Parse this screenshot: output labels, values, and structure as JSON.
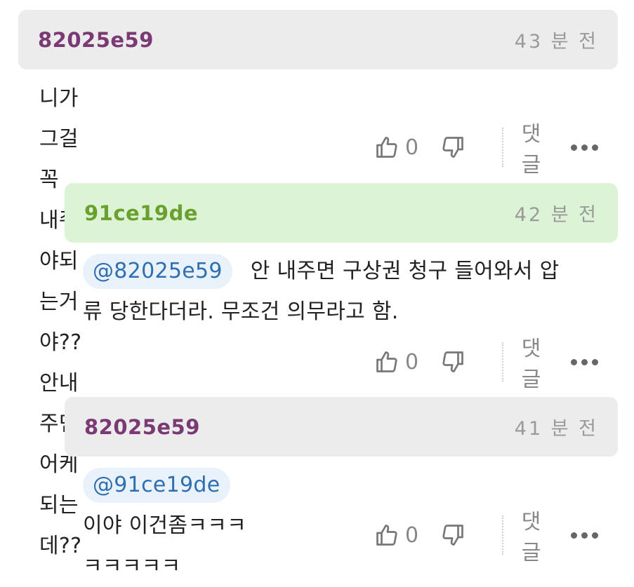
{
  "comments": [
    {
      "author": "82025e59",
      "author_color": "#7b3a74",
      "header_bg": "#ececec",
      "time": "43 분 전",
      "mention": "",
      "text": "니가 그걸 꼭 내줘야되는거야?? 안내주면어케되는데??",
      "likes": "0",
      "reply_label": "댓글"
    },
    {
      "author": "91ce19de",
      "author_color": "#6aa02e",
      "header_bg": "#ddf3d6",
      "time": "42 분 전",
      "mention": "@82025e59",
      "text_line1": "안 내주면 구상권 청구 들어와서 압",
      "text_line2": "류 당한다더라. 무조건 의무라고 함.",
      "likes": "0",
      "reply_label": "댓글"
    },
    {
      "author": "82025e59",
      "author_color": "#7b3a74",
      "header_bg": "#ececec",
      "time": "41 분 전",
      "mention": "@91ce19de",
      "text": "이야 이건좀ㅋㅋㅋㅋㅋㅋㅋㅋ",
      "likes": "0",
      "reply_label": "댓글"
    }
  ],
  "icons": {
    "like": "thumbs-up-icon",
    "dislike": "thumbs-down-icon",
    "more": "more-dots-icon"
  }
}
